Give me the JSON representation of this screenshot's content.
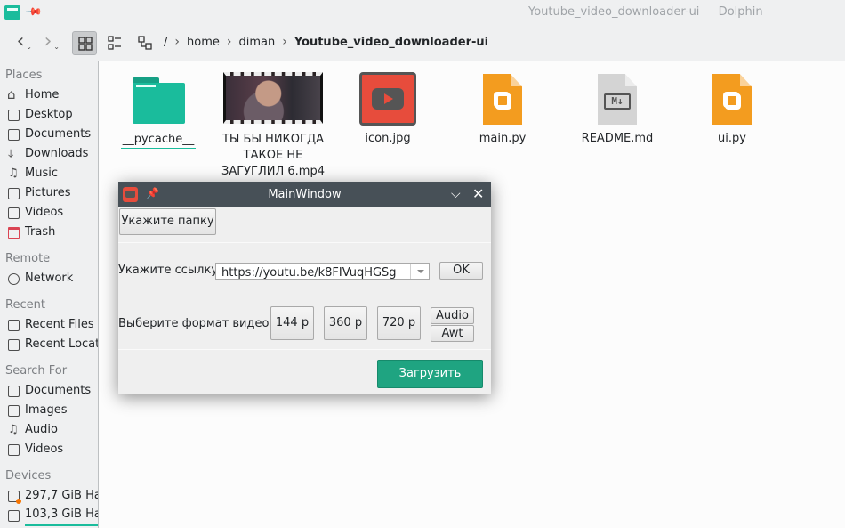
{
  "window": {
    "title": "Youtube_video_downloader-ui — Dolphin"
  },
  "breadcrumb": {
    "root": "/",
    "items": [
      "home",
      "diman",
      "Youtube_video_downloader-ui"
    ]
  },
  "sidebar": {
    "places": {
      "header": "Places",
      "items": [
        "Home",
        "Desktop",
        "Documents",
        "Downloads",
        "Music",
        "Pictures",
        "Videos",
        "Trash"
      ]
    },
    "remote": {
      "header": "Remote",
      "items": [
        "Network"
      ]
    },
    "recent": {
      "header": "Recent",
      "items": [
        "Recent Files",
        "Recent Locat"
      ]
    },
    "search": {
      "header": "Search For",
      "items": [
        "Documents",
        "Images",
        "Audio",
        "Videos"
      ]
    },
    "devices": {
      "header": "Devices",
      "items": [
        "297,7 GiB Ha",
        "103,3 GiB Ha"
      ]
    }
  },
  "files": [
    {
      "name": "__pycache__",
      "type": "folder"
    },
    {
      "name": "ТЫ БЫ НИКОГДА ТАКОЕ НЕ ЗАГУГЛИЛ 6.mp4",
      "type": "video"
    },
    {
      "name": "icon.jpg",
      "type": "image"
    },
    {
      "name": "main.py",
      "type": "python"
    },
    {
      "name": "README.md",
      "type": "markdown"
    },
    {
      "name": "ui.py",
      "type": "python"
    }
  ],
  "dialog": {
    "title": "MainWindow",
    "folder_button": "Укажите папку",
    "link_label": "Укажите ссылку :",
    "link_value": "https://youtu.be/k8FIVuqHGSg",
    "ok_button": "OK",
    "format_label": "Выберите формат видео :",
    "formats": [
      "144 p",
      "360 p",
      "720 p"
    ],
    "audio_button": "Audio",
    "awt_button": "Awt",
    "load_button": "Загрузить"
  },
  "colors": {
    "accent": "#1abc9c",
    "dialog_titlebar": "#475057",
    "load_button": "#1fa481",
    "python_file": "#f39c1f",
    "trash_icon": "#da4453"
  }
}
